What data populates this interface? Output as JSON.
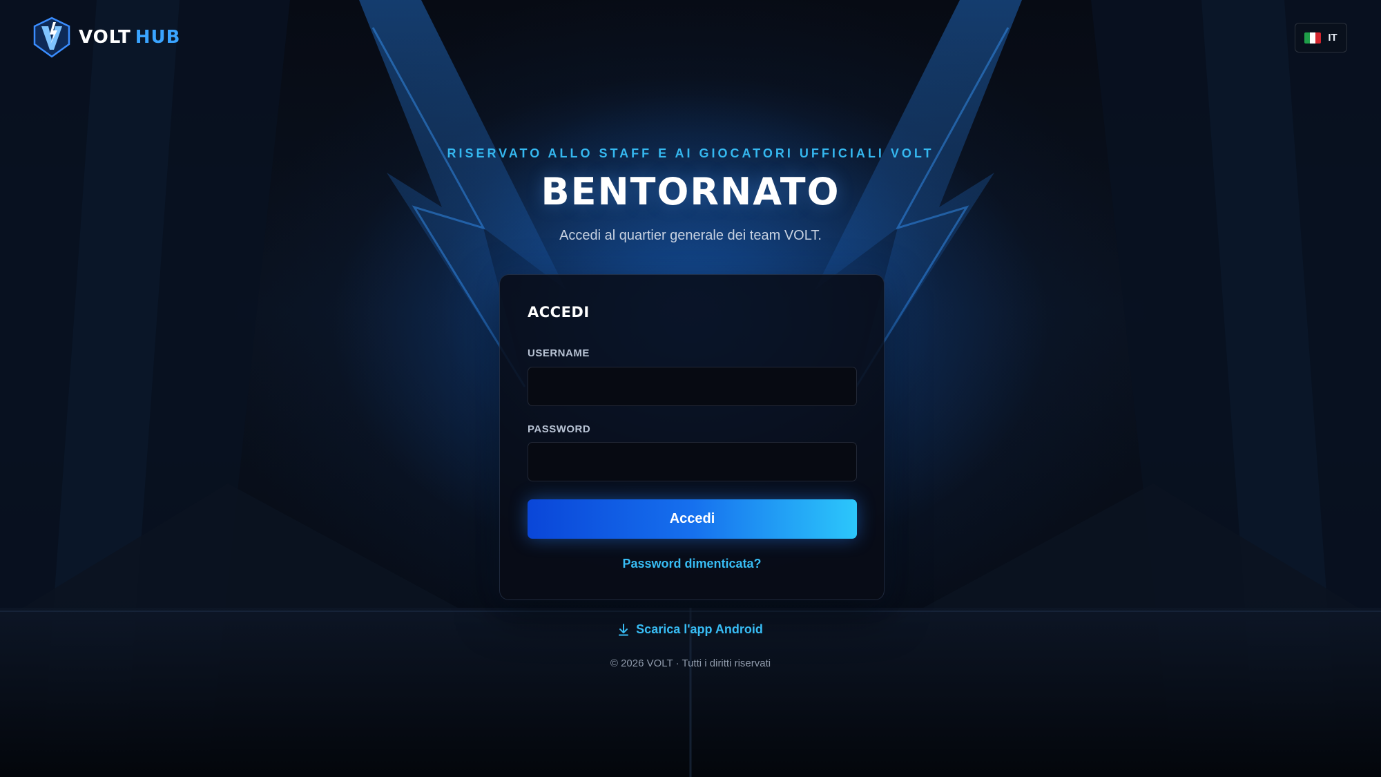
{
  "brand": {
    "name_primary": "VOLT",
    "name_secondary": "HUB",
    "logo_icon": "volt-shield-logo"
  },
  "language": {
    "code": "IT",
    "flag_icon": "italy-flag-icon",
    "flag_colors": [
      "#1f9e49",
      "#ffffff",
      "#d3252e"
    ]
  },
  "hero": {
    "kicker": "RISERVATO ALLO STAFF E AI GIOCATORI UFFICIALI VOLT",
    "title": "BENTORNATO",
    "subtitle": "Accedi al quartier generale dei team VOLT."
  },
  "login": {
    "title": "ACCEDI",
    "username_label": "USERNAME",
    "username_value": "",
    "password_label": "PASSWORD",
    "password_value": "",
    "submit_label": "Accedi",
    "forgot_link": "Password dimenticata?"
  },
  "download": {
    "icon": "download-icon",
    "label": "Scarica l'app Android"
  },
  "footer": {
    "copyright": "© 2026 VOLT · Tutti i diritti riservati"
  },
  "colors": {
    "accent": "#38bdf5",
    "button_start": "#0a46d8",
    "button_end": "#2cc7fb",
    "background": "#05080f"
  }
}
